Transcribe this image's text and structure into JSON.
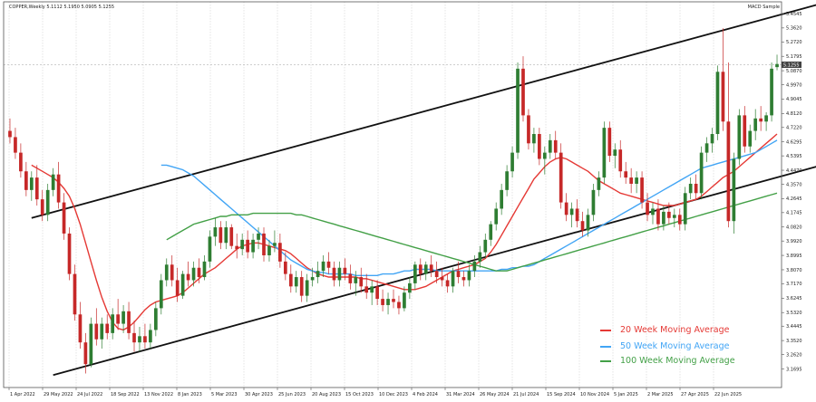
{
  "header": {
    "symbol_line": "COPPER,Weekly  5.1112 5.1950 5.0905 5.1255",
    "indicator_label": "MACD Sample"
  },
  "chart_data": {
    "type": "candlestick",
    "title": "",
    "xlabel": "",
    "ylabel": "",
    "timeframe": "Weekly",
    "ylim": [
      3.05,
      5.53
    ],
    "y_ticks": [
      "5.4545",
      "5.3620",
      "5.2720",
      "5.1795",
      "5.0870",
      "4.9970",
      "4.9045",
      "4.8120",
      "4.7220",
      "4.6295",
      "4.5395",
      "4.4470",
      "4.3570",
      "4.2645",
      "4.1745",
      "4.0820",
      "3.9920",
      "3.8995",
      "3.8070",
      "3.7170",
      "3.6245",
      "3.5320",
      "3.4445",
      "3.3520",
      "3.2620",
      "3.1695"
    ],
    "x_ticks": [
      "1 Apr 2022",
      "29 May 2022",
      "24 Jul 2022",
      "18 Sep 2022",
      "13 Nov 2022",
      "8 Jan 2023",
      "5 Mar 2023",
      "30 Apr 2023",
      "25 Jun 2023",
      "20 Aug 2023",
      "15 Oct 2023",
      "10 Dec 2023",
      "4 Feb 2024",
      "31 Mar 2024",
      "26 May 2024",
      "21 Jul 2024",
      "15 Sep 2024",
      "10 Nov 2024",
      "5 Jan 2025",
      "2 Mar 2025",
      "27 Apr 2025",
      "22 Jun 2025"
    ],
    "current_price": "5.1255",
    "colors": {
      "bull": "#2e7d32",
      "bear": "#c62828",
      "grid": "#c8c8c8"
    },
    "candles": [
      [
        4.7,
        4.78,
        4.62,
        4.66
      ],
      [
        4.66,
        4.72,
        4.52,
        4.56
      ],
      [
        4.56,
        4.62,
        4.4,
        4.44
      ],
      [
        4.44,
        4.5,
        4.28,
        4.32
      ],
      [
        4.32,
        4.44,
        4.25,
        4.4
      ],
      [
        4.4,
        4.48,
        4.22,
        4.26
      ],
      [
        4.26,
        4.32,
        4.12,
        4.16
      ],
      [
        4.16,
        4.36,
        4.12,
        4.32
      ],
      [
        4.32,
        4.46,
        4.28,
        4.42
      ],
      [
        4.42,
        4.5,
        4.2,
        4.24
      ],
      [
        4.24,
        4.3,
        4.0,
        4.04
      ],
      [
        4.04,
        4.08,
        3.74,
        3.78
      ],
      [
        3.78,
        3.84,
        3.48,
        3.52
      ],
      [
        3.52,
        3.6,
        3.3,
        3.34
      ],
      [
        3.34,
        3.4,
        3.14,
        3.2
      ],
      [
        3.2,
        3.5,
        3.18,
        3.46
      ],
      [
        3.46,
        3.56,
        3.32,
        3.36
      ],
      [
        3.36,
        3.5,
        3.3,
        3.46
      ],
      [
        3.46,
        3.52,
        3.36,
        3.4
      ],
      [
        3.4,
        3.56,
        3.36,
        3.52
      ],
      [
        3.52,
        3.62,
        3.42,
        3.46
      ],
      [
        3.46,
        3.58,
        3.4,
        3.54
      ],
      [
        3.54,
        3.6,
        3.36,
        3.4
      ],
      [
        3.4,
        3.48,
        3.28,
        3.34
      ],
      [
        3.34,
        3.44,
        3.28,
        3.38
      ],
      [
        3.38,
        3.46,
        3.3,
        3.34
      ],
      [
        3.34,
        3.46,
        3.3,
        3.42
      ],
      [
        3.42,
        3.6,
        3.38,
        3.56
      ],
      [
        3.56,
        3.78,
        3.52,
        3.74
      ],
      [
        3.74,
        3.88,
        3.7,
        3.84
      ],
      [
        3.84,
        3.9,
        3.7,
        3.74
      ],
      [
        3.74,
        3.82,
        3.6,
        3.64
      ],
      [
        3.64,
        3.8,
        3.62,
        3.78
      ],
      [
        3.78,
        3.86,
        3.7,
        3.74
      ],
      [
        3.74,
        3.86,
        3.7,
        3.82
      ],
      [
        3.82,
        3.88,
        3.72,
        3.76
      ],
      [
        3.76,
        3.9,
        3.74,
        3.86
      ],
      [
        3.86,
        4.06,
        3.82,
        4.02
      ],
      [
        4.02,
        4.14,
        3.96,
        4.08
      ],
      [
        4.08,
        4.12,
        3.94,
        3.98
      ],
      [
        3.98,
        4.12,
        3.94,
        4.08
      ],
      [
        4.08,
        4.1,
        3.94,
        3.96
      ],
      [
        3.96,
        4.04,
        3.88,
        3.94
      ],
      [
        3.94,
        4.04,
        3.9,
        4.0
      ],
      [
        4.0,
        4.06,
        3.88,
        3.92
      ],
      [
        3.92,
        4.04,
        3.88,
        4.0
      ],
      [
        4.0,
        4.08,
        3.94,
        4.04
      ],
      [
        4.04,
        4.08,
        3.86,
        3.9
      ],
      [
        3.9,
        4.0,
        3.86,
        3.96
      ],
      [
        3.96,
        4.06,
        3.92,
        3.98
      ],
      [
        3.98,
        4.04,
        3.82,
        3.86
      ],
      [
        3.86,
        3.92,
        3.74,
        3.78
      ],
      [
        3.78,
        3.84,
        3.66,
        3.7
      ],
      [
        3.7,
        3.8,
        3.66,
        3.76
      ],
      [
        3.76,
        3.8,
        3.6,
        3.64
      ],
      [
        3.64,
        3.78,
        3.6,
        3.74
      ],
      [
        3.74,
        3.82,
        3.7,
        3.76
      ],
      [
        3.76,
        3.86,
        3.72,
        3.8
      ],
      [
        3.8,
        3.9,
        3.76,
        3.86
      ],
      [
        3.86,
        3.92,
        3.78,
        3.82
      ],
      [
        3.82,
        3.86,
        3.7,
        3.74
      ],
      [
        3.74,
        3.86,
        3.7,
        3.82
      ],
      [
        3.82,
        3.88,
        3.74,
        3.78
      ],
      [
        3.78,
        3.84,
        3.68,
        3.72
      ],
      [
        3.72,
        3.8,
        3.64,
        3.76
      ],
      [
        3.76,
        3.82,
        3.66,
        3.7
      ],
      [
        3.7,
        3.78,
        3.62,
        3.66
      ],
      [
        3.66,
        3.74,
        3.58,
        3.7
      ],
      [
        3.7,
        3.74,
        3.58,
        3.62
      ],
      [
        3.62,
        3.68,
        3.54,
        3.58
      ],
      [
        3.58,
        3.66,
        3.52,
        3.62
      ],
      [
        3.62,
        3.68,
        3.56,
        3.6
      ],
      [
        3.6,
        3.64,
        3.52,
        3.56
      ],
      [
        3.56,
        3.7,
        3.54,
        3.66
      ],
      [
        3.66,
        3.76,
        3.62,
        3.72
      ],
      [
        3.72,
        3.86,
        3.68,
        3.84
      ],
      [
        3.84,
        3.88,
        3.74,
        3.78
      ],
      [
        3.78,
        3.86,
        3.74,
        3.84
      ],
      [
        3.84,
        3.9,
        3.76,
        3.8
      ],
      [
        3.8,
        3.86,
        3.72,
        3.76
      ],
      [
        3.76,
        3.82,
        3.7,
        3.74
      ],
      [
        3.74,
        3.78,
        3.66,
        3.7
      ],
      [
        3.7,
        3.82,
        3.66,
        3.8
      ],
      [
        3.8,
        3.86,
        3.72,
        3.76
      ],
      [
        3.76,
        3.8,
        3.7,
        3.74
      ],
      [
        3.74,
        3.84,
        3.7,
        3.8
      ],
      [
        3.8,
        3.9,
        3.76,
        3.86
      ],
      [
        3.86,
        3.96,
        3.82,
        3.92
      ],
      [
        3.92,
        4.04,
        3.88,
        4.0
      ],
      [
        4.0,
        4.12,
        3.96,
        4.1
      ],
      [
        4.1,
        4.24,
        4.06,
        4.2
      ],
      [
        4.2,
        4.36,
        4.16,
        4.32
      ],
      [
        4.32,
        4.48,
        4.28,
        4.44
      ],
      [
        4.44,
        4.6,
        4.4,
        4.56
      ],
      [
        4.56,
        5.14,
        4.52,
        5.1
      ],
      [
        5.1,
        5.18,
        4.76,
        4.8
      ],
      [
        4.8,
        4.84,
        4.58,
        4.62
      ],
      [
        4.62,
        4.72,
        4.56,
        4.68
      ],
      [
        4.68,
        4.72,
        4.48,
        4.52
      ],
      [
        4.52,
        4.6,
        4.42,
        4.56
      ],
      [
        4.56,
        4.68,
        4.52,
        4.64
      ],
      [
        4.64,
        4.7,
        4.52,
        4.56
      ],
      [
        4.56,
        4.62,
        4.2,
        4.24
      ],
      [
        4.24,
        4.3,
        4.12,
        4.16
      ],
      [
        4.16,
        4.24,
        4.08,
        4.2
      ],
      [
        4.2,
        4.26,
        4.08,
        4.12
      ],
      [
        4.12,
        4.18,
        4.02,
        4.06
      ],
      [
        4.06,
        4.2,
        4.02,
        4.16
      ],
      [
        4.16,
        4.36,
        4.12,
        4.32
      ],
      [
        4.32,
        4.44,
        4.28,
        4.4
      ],
      [
        4.4,
        4.76,
        4.36,
        4.72
      ],
      [
        4.72,
        4.76,
        4.5,
        4.54
      ],
      [
        4.54,
        4.62,
        4.46,
        4.58
      ],
      [
        4.58,
        4.64,
        4.4,
        4.44
      ],
      [
        4.44,
        4.5,
        4.36,
        4.4
      ],
      [
        4.4,
        4.46,
        4.3,
        4.36
      ],
      [
        4.36,
        4.44,
        4.3,
        4.4
      ],
      [
        4.4,
        4.44,
        4.2,
        4.24
      ],
      [
        4.24,
        4.3,
        4.12,
        4.16
      ],
      [
        4.16,
        4.24,
        4.1,
        4.2
      ],
      [
        4.2,
        4.26,
        4.06,
        4.1
      ],
      [
        4.1,
        4.22,
        4.06,
        4.18
      ],
      [
        4.18,
        4.24,
        4.1,
        4.14
      ],
      [
        4.14,
        4.2,
        4.08,
        4.16
      ],
      [
        4.16,
        4.2,
        4.06,
        4.1
      ],
      [
        4.1,
        4.34,
        4.06,
        4.3
      ],
      [
        4.3,
        4.4,
        4.26,
        4.36
      ],
      [
        4.36,
        4.42,
        4.26,
        4.3
      ],
      [
        4.3,
        4.6,
        4.26,
        4.56
      ],
      [
        4.56,
        4.66,
        4.5,
        4.62
      ],
      [
        4.62,
        4.72,
        4.56,
        4.68
      ],
      [
        4.68,
        5.12,
        4.64,
        5.08
      ],
      [
        5.08,
        5.36,
        4.7,
        4.76
      ],
      [
        4.76,
        5.14,
        4.08,
        4.12
      ],
      [
        4.12,
        4.56,
        4.04,
        4.52
      ],
      [
        4.52,
        4.84,
        4.48,
        4.8
      ],
      [
        4.8,
        4.86,
        4.56,
        4.6
      ],
      [
        4.6,
        4.74,
        4.56,
        4.7
      ],
      [
        4.7,
        4.84,
        4.64,
        4.78
      ],
      [
        4.78,
        4.86,
        4.7,
        4.76
      ],
      [
        4.76,
        4.82,
        4.7,
        4.8
      ],
      [
        4.8,
        5.14,
        4.76,
        5.1
      ],
      [
        5.11,
        5.19,
        5.09,
        5.13
      ]
    ],
    "series": [
      {
        "name": "20 Week Moving Average",
        "color": "#e53935",
        "values": [
          4.48,
          4.46,
          4.44,
          4.42,
          4.4,
          4.37,
          4.33,
          4.28,
          4.2,
          4.1,
          3.98,
          3.86,
          3.74,
          3.63,
          3.54,
          3.47,
          3.43,
          3.42,
          3.44,
          3.47,
          3.51,
          3.55,
          3.58,
          3.6,
          3.61,
          3.62,
          3.63,
          3.64,
          3.66,
          3.69,
          3.72,
          3.75,
          3.78,
          3.8,
          3.82,
          3.85,
          3.88,
          3.91,
          3.94,
          3.96,
          3.97,
          3.98,
          3.98,
          3.97,
          3.96,
          3.95,
          3.94,
          3.93,
          3.91,
          3.88,
          3.85,
          3.82,
          3.8,
          3.78,
          3.77,
          3.76,
          3.76,
          3.76,
          3.76,
          3.76,
          3.76,
          3.75,
          3.75,
          3.74,
          3.73,
          3.72,
          3.71,
          3.7,
          3.69,
          3.68,
          3.68,
          3.68,
          3.69,
          3.7,
          3.72,
          3.74,
          3.76,
          3.78,
          3.8,
          3.81,
          3.82,
          3.83,
          3.84,
          3.86,
          3.88,
          3.92,
          3.97,
          4.03,
          4.09,
          4.15,
          4.21,
          4.27,
          4.33,
          4.39,
          4.43,
          4.47,
          4.5,
          4.52,
          4.53,
          4.52,
          4.5,
          4.48,
          4.46,
          4.44,
          4.41,
          4.38,
          4.36,
          4.34,
          4.32,
          4.3,
          4.29,
          4.28,
          4.27,
          4.26,
          4.25,
          4.24,
          4.23,
          4.22,
          4.22,
          4.22,
          4.23,
          4.24,
          4.25,
          4.26,
          4.28,
          4.31,
          4.34,
          4.37,
          4.4,
          4.42,
          4.44,
          4.47,
          4.5,
          4.53,
          4.56,
          4.59,
          4.62,
          4.65,
          4.68
        ]
      },
      {
        "name": "50 Week Moving Average",
        "color": "#42a5f5",
        "values": [
          4.48,
          4.48,
          4.47,
          4.46,
          4.45,
          4.43,
          4.41,
          4.38,
          4.35,
          4.32,
          4.29,
          4.26,
          4.23,
          4.2,
          4.17,
          4.14,
          4.11,
          4.08,
          4.05,
          4.02,
          3.99,
          3.96,
          3.93,
          3.9,
          3.87,
          3.85,
          3.83,
          3.81,
          3.8,
          3.79,
          3.79,
          3.78,
          3.78,
          3.78,
          3.78,
          3.78,
          3.77,
          3.77,
          3.77,
          3.77,
          3.77,
          3.78,
          3.78,
          3.78,
          3.79,
          3.8,
          3.8,
          3.81,
          3.81,
          3.81,
          3.81,
          3.8,
          3.8,
          3.8,
          3.8,
          3.8,
          3.8,
          3.8,
          3.8,
          3.8,
          3.8,
          3.8,
          3.8,
          3.81,
          3.81,
          3.82,
          3.82,
          3.83,
          3.83,
          3.84,
          3.86,
          3.88,
          3.9,
          3.92,
          3.94,
          3.96,
          3.98,
          4.0,
          4.02,
          4.04,
          4.06,
          4.08,
          4.1,
          4.12,
          4.14,
          4.16,
          4.18,
          4.2,
          4.22,
          4.24,
          4.26,
          4.28,
          4.3,
          4.32,
          4.34,
          4.36,
          4.38,
          4.4,
          4.42,
          4.44,
          4.46,
          4.47,
          4.48,
          4.49,
          4.5,
          4.51,
          4.52,
          4.53,
          4.54,
          4.55,
          4.56,
          4.58,
          4.6,
          4.62,
          4.64
        ]
      },
      {
        "name": "100 Week Moving Average",
        "color": "#43a047",
        "values": [
          4.0,
          4.02,
          4.04,
          4.06,
          4.08,
          4.1,
          4.11,
          4.12,
          4.13,
          4.14,
          4.15,
          4.15,
          4.16,
          4.16,
          4.16,
          4.16,
          4.17,
          4.17,
          4.17,
          4.17,
          4.17,
          4.17,
          4.17,
          4.17,
          4.16,
          4.16,
          4.15,
          4.14,
          4.13,
          4.12,
          4.11,
          4.1,
          4.09,
          4.08,
          4.07,
          4.06,
          4.05,
          4.04,
          4.03,
          4.02,
          4.01,
          4.0,
          3.99,
          3.98,
          3.97,
          3.96,
          3.95,
          3.94,
          3.93,
          3.92,
          3.91,
          3.9,
          3.89,
          3.88,
          3.87,
          3.86,
          3.85,
          3.84,
          3.83,
          3.82,
          3.81,
          3.8,
          3.8,
          3.8,
          3.81,
          3.82,
          3.83,
          3.84,
          3.85,
          3.86,
          3.87,
          3.88,
          3.89,
          3.9,
          3.91,
          3.92,
          3.93,
          3.94,
          3.95,
          3.96,
          3.97,
          3.98,
          3.99,
          4.0,
          4.01,
          4.02,
          4.03,
          4.04,
          4.05,
          4.06,
          4.07,
          4.08,
          4.09,
          4.1,
          4.11,
          4.12,
          4.13,
          4.14,
          4.15,
          4.16,
          4.17,
          4.18,
          4.19,
          4.2,
          4.21,
          4.22,
          4.23,
          4.24,
          4.25,
          4.26,
          4.27,
          4.28,
          4.29,
          4.3
        ]
      }
    ],
    "channel_lines": [
      {
        "name": "upper",
        "from": [
          4,
          4.14
        ],
        "to": [
          144,
          5.46
        ]
      },
      {
        "name": "lower",
        "from": [
          8,
          3.13
        ],
        "to": [
          144,
          4.42
        ]
      }
    ],
    "legend_position": "bottom-right"
  }
}
